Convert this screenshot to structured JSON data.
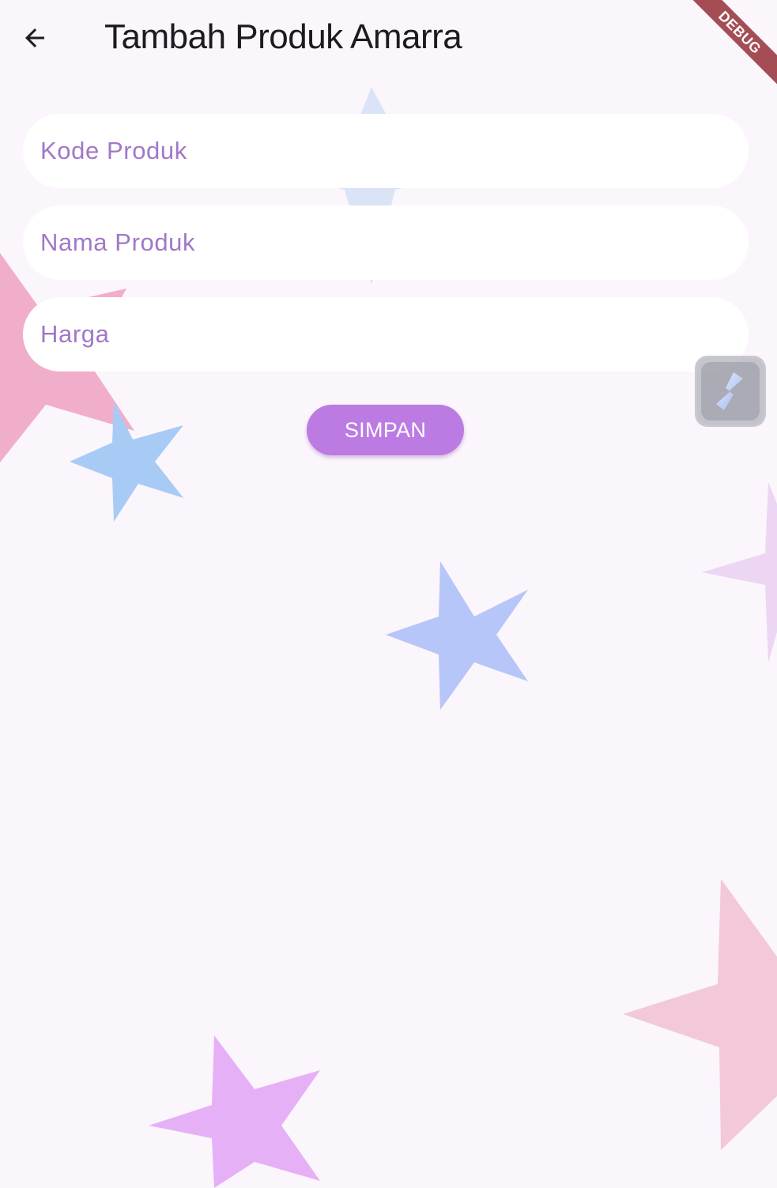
{
  "appbar": {
    "title": "Tambah Produk Amarra",
    "back_icon": "arrow-back-icon"
  },
  "debug_banner": {
    "label": "DEBUG",
    "color": "#a44d55"
  },
  "form": {
    "kode_produk": {
      "placeholder": "Kode Produk",
      "value": ""
    },
    "nama_produk": {
      "placeholder": "Nama Produk",
      "value": ""
    },
    "harga": {
      "placeholder": "Harga",
      "value": ""
    },
    "save_label": "SIMPAN"
  },
  "floating_tool": {
    "icon": "lightning-tool-icon"
  },
  "colors": {
    "background": "#fbf5fc",
    "accent": "#bb7be3",
    "placeholder": "#a178c8",
    "star_pink": "#f0a6c4",
    "star_blue": "#a8cbf5",
    "star_periwinkle": "#b6c6f8",
    "star_lavender": "#ecd6f3",
    "star_violet": "#e6b0f7"
  }
}
